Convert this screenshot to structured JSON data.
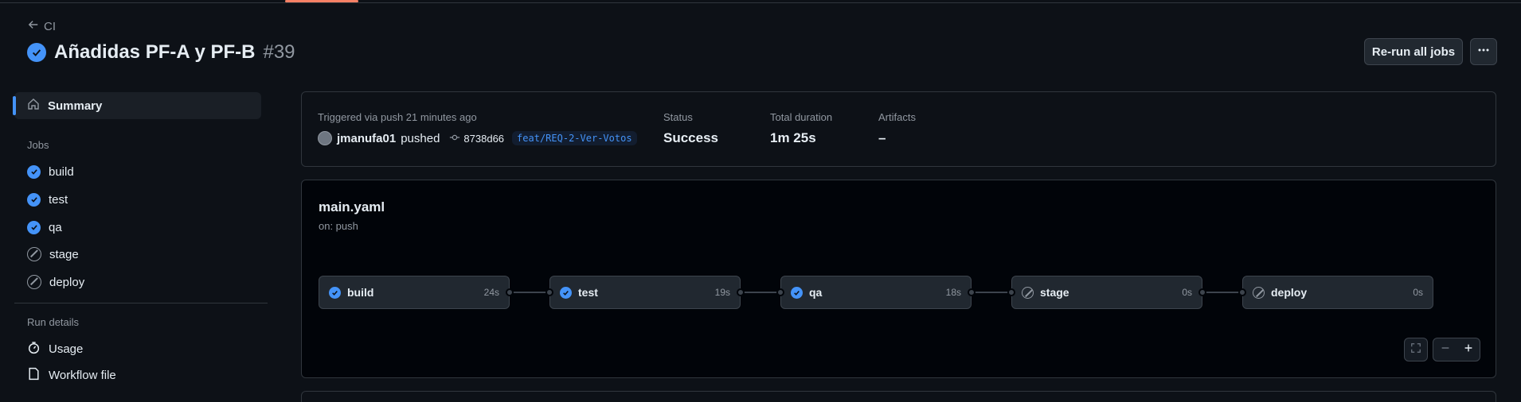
{
  "header": {
    "back_label": "CI",
    "run_title": "Añadidas PF-A y PF-B",
    "run_number": "#39",
    "rerun_label": "Re-run all jobs",
    "more_icon": "kebab-horizontal-icon"
  },
  "sidebar": {
    "summary_label": "Summary",
    "jobs_heading": "Jobs",
    "jobs": [
      {
        "label": "build",
        "status": "success"
      },
      {
        "label": "test",
        "status": "success"
      },
      {
        "label": "qa",
        "status": "success"
      },
      {
        "label": "stage",
        "status": "skipped"
      },
      {
        "label": "deploy",
        "status": "skipped"
      }
    ],
    "run_details_heading": "Run details",
    "usage_label": "Usage",
    "workflow_file_label": "Workflow file"
  },
  "summary": {
    "trigger_text": "Triggered via push 21 minutes ago",
    "actor": "jmanufa01",
    "action": "pushed",
    "commit": "8738d66",
    "branch": "feat/REQ-2-Ver-Votos",
    "status_label": "Status",
    "status_value": "Success",
    "duration_label": "Total duration",
    "duration_value": "1m 25s",
    "artifacts_label": "Artifacts",
    "artifacts_value": "–"
  },
  "graph": {
    "workflow_name": "main.yaml",
    "trigger": "on: push",
    "jobs": [
      {
        "label": "build",
        "duration": "24s",
        "status": "success"
      },
      {
        "label": "test",
        "duration": "19s",
        "status": "success"
      },
      {
        "label": "qa",
        "duration": "18s",
        "status": "success"
      },
      {
        "label": "stage",
        "duration": "0s",
        "status": "skipped"
      },
      {
        "label": "deploy",
        "duration": "0s",
        "status": "skipped"
      }
    ],
    "zoom_controls": [
      "fullscreen-icon",
      "zoom-out-icon",
      "zoom-in-icon"
    ]
  },
  "colors": {
    "accent": "#4493f8",
    "background": "#0d1117",
    "tab_underline": "#f78166"
  }
}
